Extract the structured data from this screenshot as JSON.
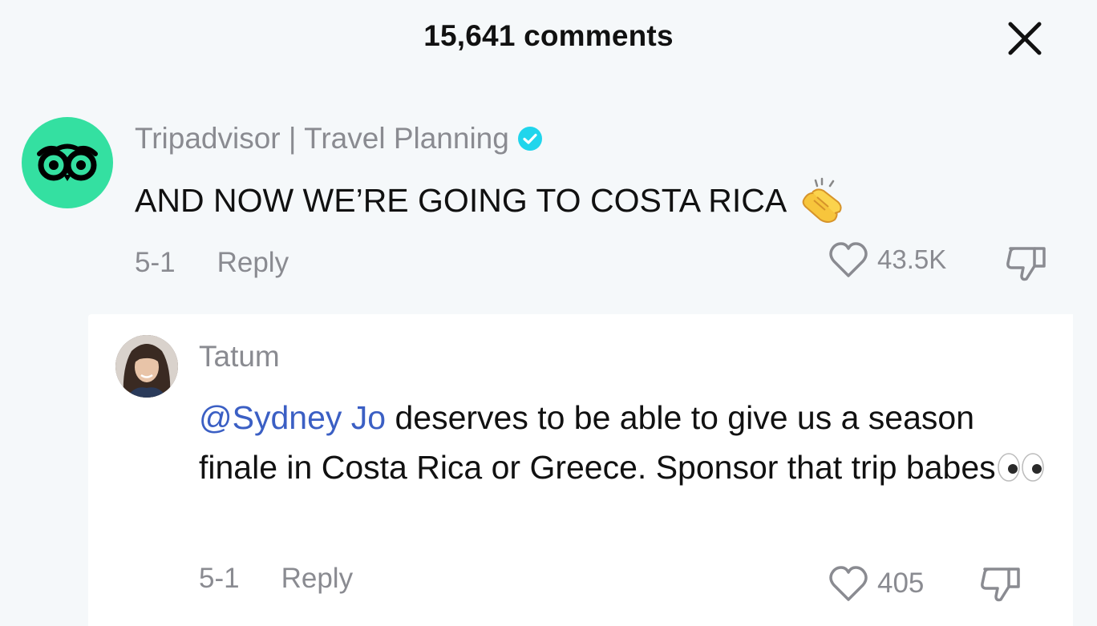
{
  "header": {
    "title": "15,641 comments",
    "close_icon": "close-icon"
  },
  "comments": [
    {
      "username": "Tripadvisor | Travel Planning",
      "verified": true,
      "avatar_icon": "tripadvisor-owl-logo",
      "text": "AND NOW WE’RE GOING TO COSTA RICA",
      "emoji": "clapping-hands-emoji",
      "date": "5-1",
      "reply_label": "Reply",
      "likes": "43.5K",
      "colors": {
        "avatar_bg": "#34e0a1",
        "verified": "#20d5ec"
      }
    }
  ],
  "replies": [
    {
      "username": "Tatum",
      "avatar_icon": "user-photo",
      "mention": "@Sydney Jo",
      "text": " deserves to be able to give us a season finale in Costa Rica or Greece. Sponsor that trip babes",
      "emoji": "eyes-emoji",
      "date": "5-1",
      "reply_label": "Reply",
      "likes": "405",
      "colors": {
        "mention": "#3b5fc4"
      }
    }
  ],
  "colors": {
    "background": "#f5f8fa",
    "reply_background": "#ffffff",
    "secondary_text": "#8a8b91",
    "primary_text": "#111111"
  }
}
